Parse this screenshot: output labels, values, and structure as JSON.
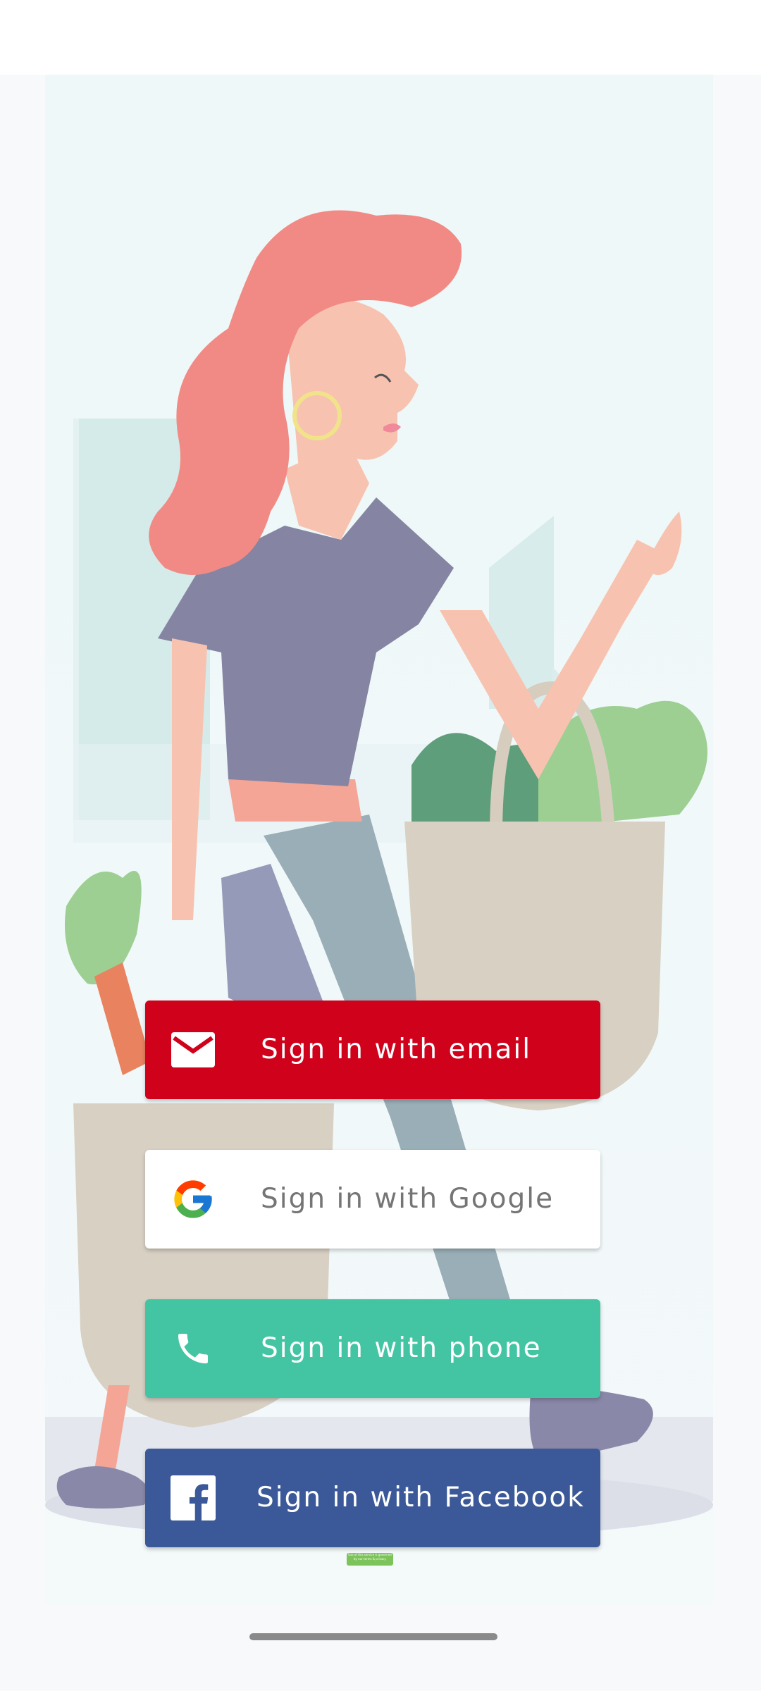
{
  "buttons": {
    "email": {
      "label": "Sign in with email",
      "color": "#d0021b",
      "icon": "mail-icon"
    },
    "google": {
      "label": "Sign in with Google",
      "color": "#ffffff",
      "icon": "google-logo-icon"
    },
    "phone": {
      "label": "Sign in with phone",
      "color": "#43c5a4",
      "icon": "phone-icon"
    },
    "facebook": {
      "label": "Sign in with Facebook",
      "color": "#3b5998",
      "icon": "facebook-logo-icon"
    }
  },
  "legal": {
    "text": "Use of this service is governed by our terms & privacy"
  }
}
